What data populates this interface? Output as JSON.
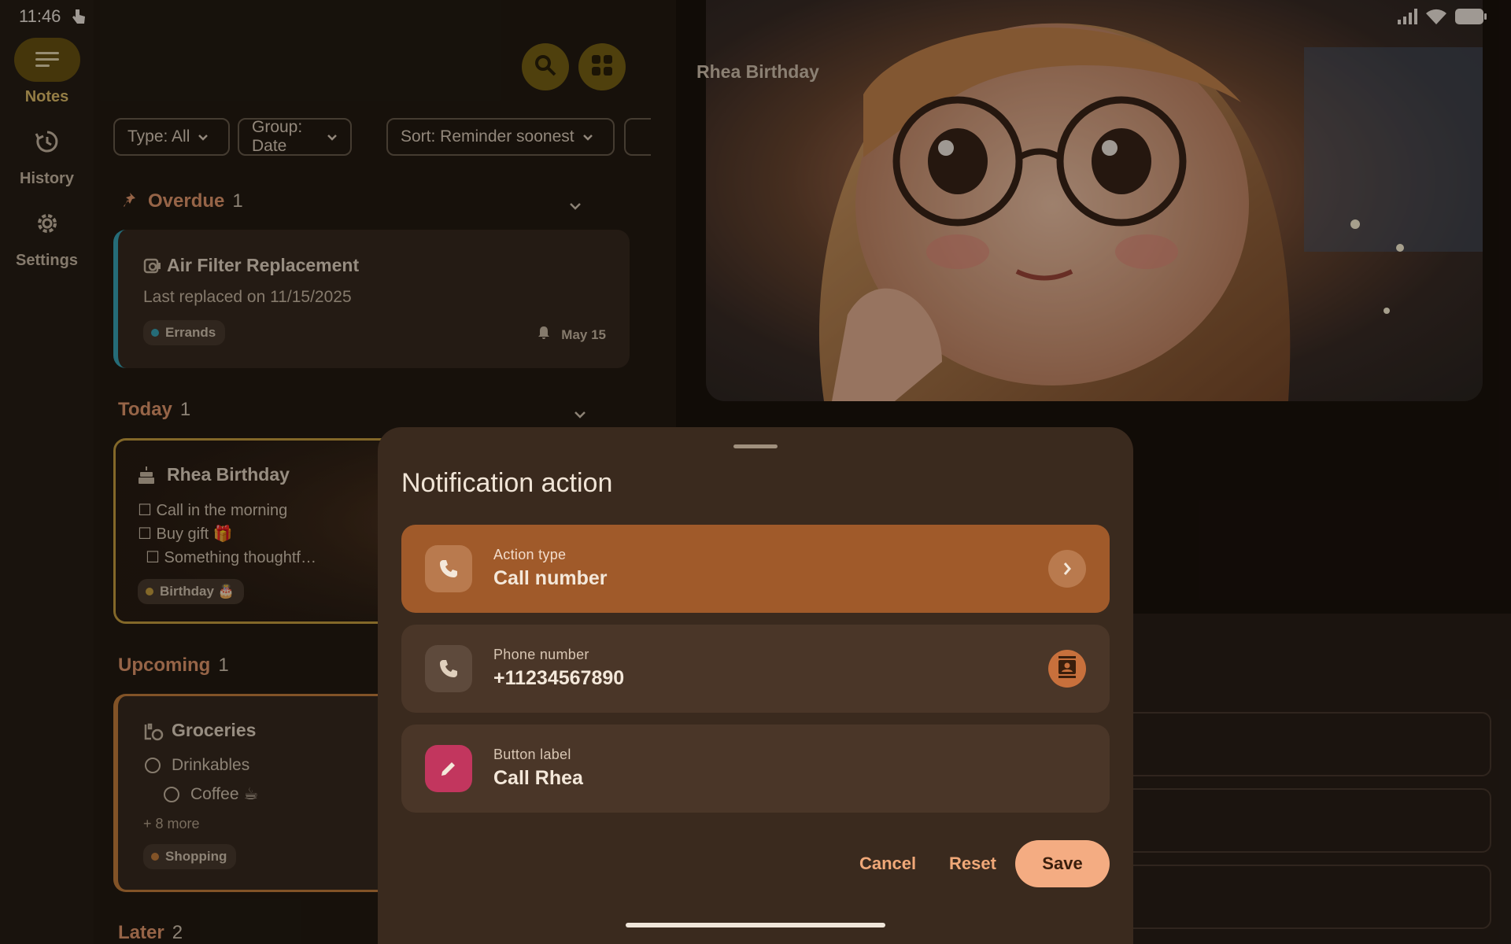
{
  "status": {
    "time": "11:46"
  },
  "rail": {
    "items": [
      {
        "label": "Notes",
        "icon": "notes-icon",
        "active": true
      },
      {
        "label": "History",
        "icon": "history-icon",
        "active": false
      },
      {
        "label": "Settings",
        "icon": "gear-icon",
        "active": false
      }
    ]
  },
  "filters": [
    "Type: All",
    "Group: Date",
    "Sort: Reminder soonest"
  ],
  "sections": {
    "overdue": {
      "label": "Overdue",
      "count": "1"
    },
    "today": {
      "label": "Today",
      "count": "1"
    },
    "upcoming": {
      "label": "Upcoming",
      "count": "1"
    },
    "later": {
      "label": "Later",
      "count": "2"
    }
  },
  "cards": {
    "air_filter": {
      "title": "Air Filter Replacement",
      "body": "Last replaced on 11/15/2025",
      "tag": "Errands",
      "reminder": "May 15",
      "accent": "#3aa6b8"
    },
    "rhea": {
      "title": "Rhea Birthday",
      "items": [
        "☐ Call in the morning",
        "☐ Buy gift 🎁",
        "☐ Something thoughtf…"
      ],
      "tag": "Birthday 🎂",
      "accent": "#c9a040"
    },
    "groceries": {
      "title": "Groceries",
      "items": [
        "Drinkables",
        "Coffee ☕"
      ],
      "more": "+ 8 more",
      "tag": "Shopping",
      "accent": "#c8803c"
    }
  },
  "detail": {
    "title": "Rhea Birthday"
  },
  "sheet": {
    "title": "Notification action",
    "options": [
      {
        "label": "Action type",
        "value": "Call number"
      },
      {
        "label": "Phone number",
        "value": "+11234567890"
      },
      {
        "label": "Button label",
        "value": "Call Rhea"
      }
    ],
    "cancel": "Cancel",
    "reset": "Reset",
    "save": "Save"
  },
  "colors": {
    "accent": "#a05a2a",
    "save": "#f4ac82",
    "rail_active": "#6a5412"
  }
}
